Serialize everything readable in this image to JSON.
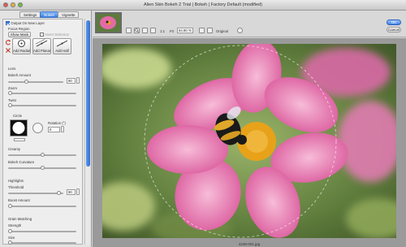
{
  "window": {
    "title": "Alien Skin Bokeh 2 Trial | Bokeh | Factory Default (modified)"
  },
  "tabs": [
    {
      "label": "Settings"
    },
    {
      "label": "Bokeh",
      "active": true
    },
    {
      "label": "Vignette"
    }
  ],
  "panel": {
    "output_layer": {
      "label": "Output On New Layer",
      "checked": true
    },
    "focus_region": {
      "heading": "Focus Region",
      "show_mask": "Show Mask",
      "invert_selection": {
        "label": "Invert Selection",
        "checked": false
      },
      "buttons": [
        "Add Radial",
        "Add Planar",
        "Add Half"
      ]
    },
    "lens": {
      "heading": "Lens",
      "bokeh_amount": {
        "label": "Bokeh Amount",
        "value": "90",
        "level": 0.3
      },
      "zoom": {
        "label": "Zoom",
        "level": 0.05
      },
      "twist": {
        "label": "Twist",
        "level": 0.05
      }
    },
    "circle": {
      "heading": "Circle",
      "rotation_label": "Rotation (°)",
      "rotation_value": "0"
    },
    "creamy": {
      "label": "Creamy",
      "level": 0.5
    },
    "bokeh_curvature": {
      "label": "Bokeh Curvature",
      "level": 0.5
    },
    "highlights": {
      "heading": "Highlights",
      "threshold": {
        "label": "Threshold",
        "value": "90",
        "level": 0.88
      },
      "boost_amount": {
        "label": "Boost Amount",
        "level": 0.05
      }
    },
    "grain": {
      "heading": "Grain Matching",
      "strength": {
        "label": "Strength",
        "level": 0.05
      },
      "size": {
        "label": "Size",
        "level": 0.05
      }
    }
  },
  "toolbar": {
    "zoom_label": "1:1",
    "fit_label": "Fit",
    "zoom_value": "64.80 %",
    "view_label": "Original",
    "ok_label": "OK",
    "cancel_label": "Cancel"
  },
  "image": {
    "filename": "4248-001.jpg"
  },
  "colors": {
    "accent": "#3b7fe0",
    "petal": "#e46aa5",
    "bee_yellow": "#e8a21a"
  }
}
